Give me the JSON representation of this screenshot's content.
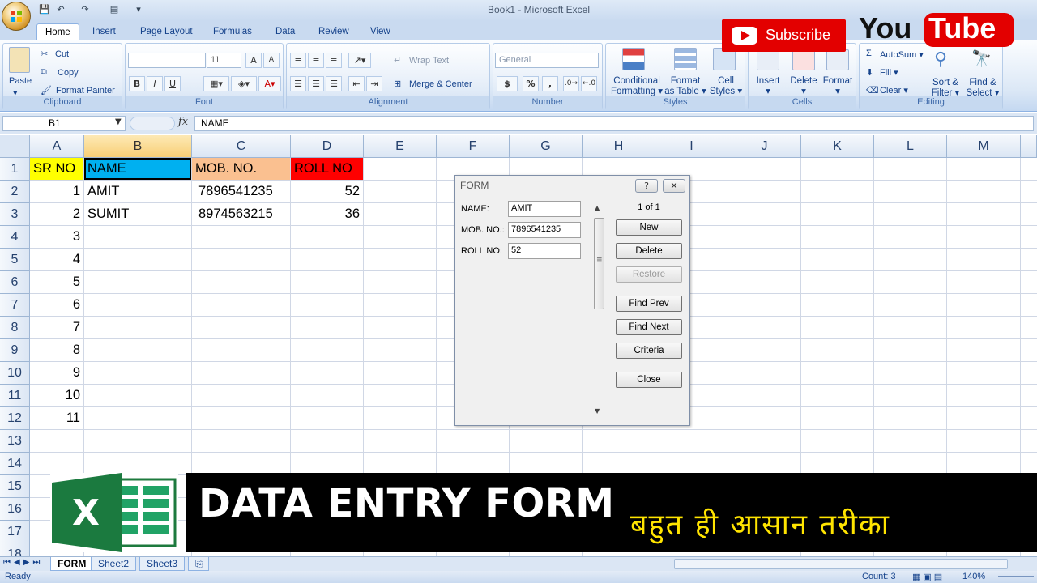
{
  "window": {
    "title": "Book1 - Microsoft Excel"
  },
  "tabs": [
    "Home",
    "Insert",
    "Page Layout",
    "Formulas",
    "Data",
    "Review",
    "View"
  ],
  "ribbon": {
    "clipboard": {
      "paste": "Paste",
      "cut": "Cut",
      "copy": "Copy",
      "format_painter": "Format Painter",
      "label": "Clipboard"
    },
    "font": {
      "size": "11",
      "bold": "B",
      "italic": "I",
      "underline": "U",
      "label": "Font"
    },
    "alignment": {
      "wrap": "Wrap Text",
      "merge": "Merge & Center",
      "label": "Alignment"
    },
    "number": {
      "format": "General",
      "currency": "$",
      "percent": "%",
      "comma": ",",
      "label": "Number"
    },
    "styles": {
      "conditional1": "Conditional",
      "conditional2": "Formatting",
      "table1": "Format",
      "table2": "as Table",
      "cell1": "Cell",
      "cell2": "Styles",
      "label": "Styles"
    },
    "cells": {
      "insert": "Insert",
      "delete": "Delete",
      "format": "Format",
      "label": "Cells"
    },
    "editing": {
      "autosum": "AutoSum",
      "fill": "Fill",
      "clear": "Clear",
      "sort1": "Sort &",
      "sort2": "Filter",
      "find1": "Find &",
      "find2": "Select",
      "label": "Editing"
    }
  },
  "formula_bar": {
    "name_box": "B1",
    "fx": "fx",
    "formula": "NAME"
  },
  "columns": [
    "A",
    "B",
    "C",
    "D",
    "E",
    "F",
    "G",
    "H",
    "I",
    "J",
    "K",
    "L",
    "M"
  ],
  "rows": [
    "1",
    "2",
    "3",
    "4",
    "5",
    "6",
    "7",
    "8",
    "9",
    "10",
    "11",
    "12",
    "13",
    "14",
    "15",
    "16",
    "17",
    "18"
  ],
  "sheet": {
    "headers": {
      "sr": "SR NO",
      "name": "NAME",
      "mob": "MOB. NO.",
      "roll": "ROLL NO"
    },
    "header_colors": {
      "sr": "#ffff00",
      "name": "#00b0f0",
      "mob": "#fac090",
      "roll": "#ff0000"
    },
    "sr_values": [
      "1",
      "2",
      "3",
      "4",
      "5",
      "6",
      "7",
      "8",
      "9",
      "10",
      "11"
    ],
    "records": [
      {
        "name": "AMIT",
        "mob": "7896541235",
        "roll": "52"
      },
      {
        "name": "SUMIT",
        "mob": "8974563215",
        "roll": "36"
      }
    ]
  },
  "form": {
    "title": "FORM",
    "help": "?",
    "close_x": "✕",
    "labels": {
      "name": "NAME:",
      "mob": "MOB. NO.:",
      "roll": "ROLL NO:"
    },
    "values": {
      "name": "AMIT",
      "mob": "7896541235",
      "roll": "52"
    },
    "record_counter": "1 of 1",
    "buttons": {
      "new": "New",
      "delete": "Delete",
      "restore": "Restore",
      "find_prev": "Find Prev",
      "find_next": "Find Next",
      "criteria": "Criteria",
      "close": "Close"
    }
  },
  "banner": {
    "title": "DATA ENTRY FORM",
    "subtitle": "बहुत ही आसान तरीका"
  },
  "youtube": {
    "subscribe": "Subscribe",
    "you": "You",
    "tube": "Tube"
  },
  "sheet_tabs": [
    "FORM",
    "Sheet2",
    "Sheet3"
  ],
  "status": {
    "ready": "Ready",
    "count": "Count: 3",
    "zoom": "140%"
  }
}
